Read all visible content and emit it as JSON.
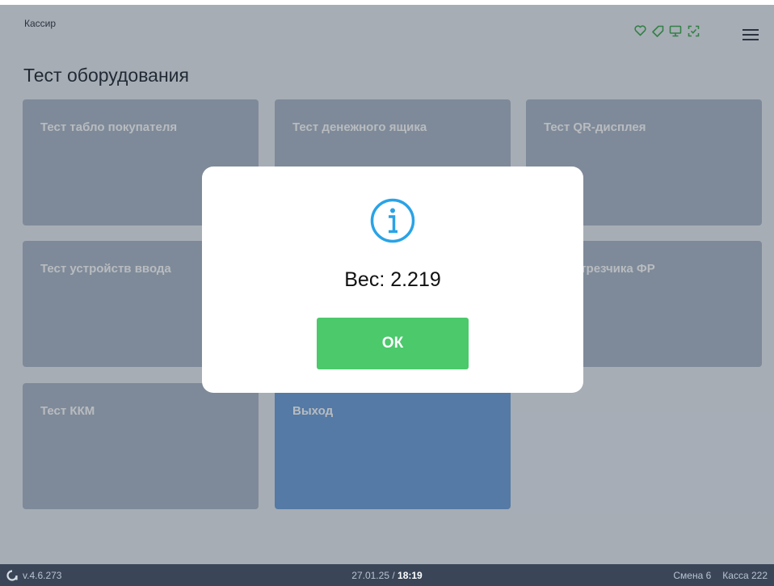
{
  "header": {
    "role": "Кассир",
    "icons": [
      "heart-icon",
      "tag-icon",
      "monitor-icon",
      "scan-icon"
    ],
    "menu_icon": "hamburger-menu-icon",
    "accent_color": "#3aa84d"
  },
  "page": {
    "title": "Тест оборудования"
  },
  "tiles": [
    {
      "label": "Тест табло покупателя"
    },
    {
      "label": "Тест денежного ящика"
    },
    {
      "label": "Тест QR-дисплея"
    },
    {
      "label": "Тест устройств ввода"
    },
    {
      "label": "Тест отрезчика ФР"
    },
    {
      "label": "Тест ККМ"
    },
    {
      "label": "Выход"
    }
  ],
  "dialog": {
    "icon": "info-icon",
    "message": "Вес: 2.219",
    "ok_label": "ОК",
    "icon_color": "#2aa3e6",
    "button_color": "#4bc96b"
  },
  "footer": {
    "version": "v.4.6.273",
    "date": "27.01.25 /",
    "time": "18:19",
    "shift": "Смена 6",
    "register": "Касса 222"
  }
}
